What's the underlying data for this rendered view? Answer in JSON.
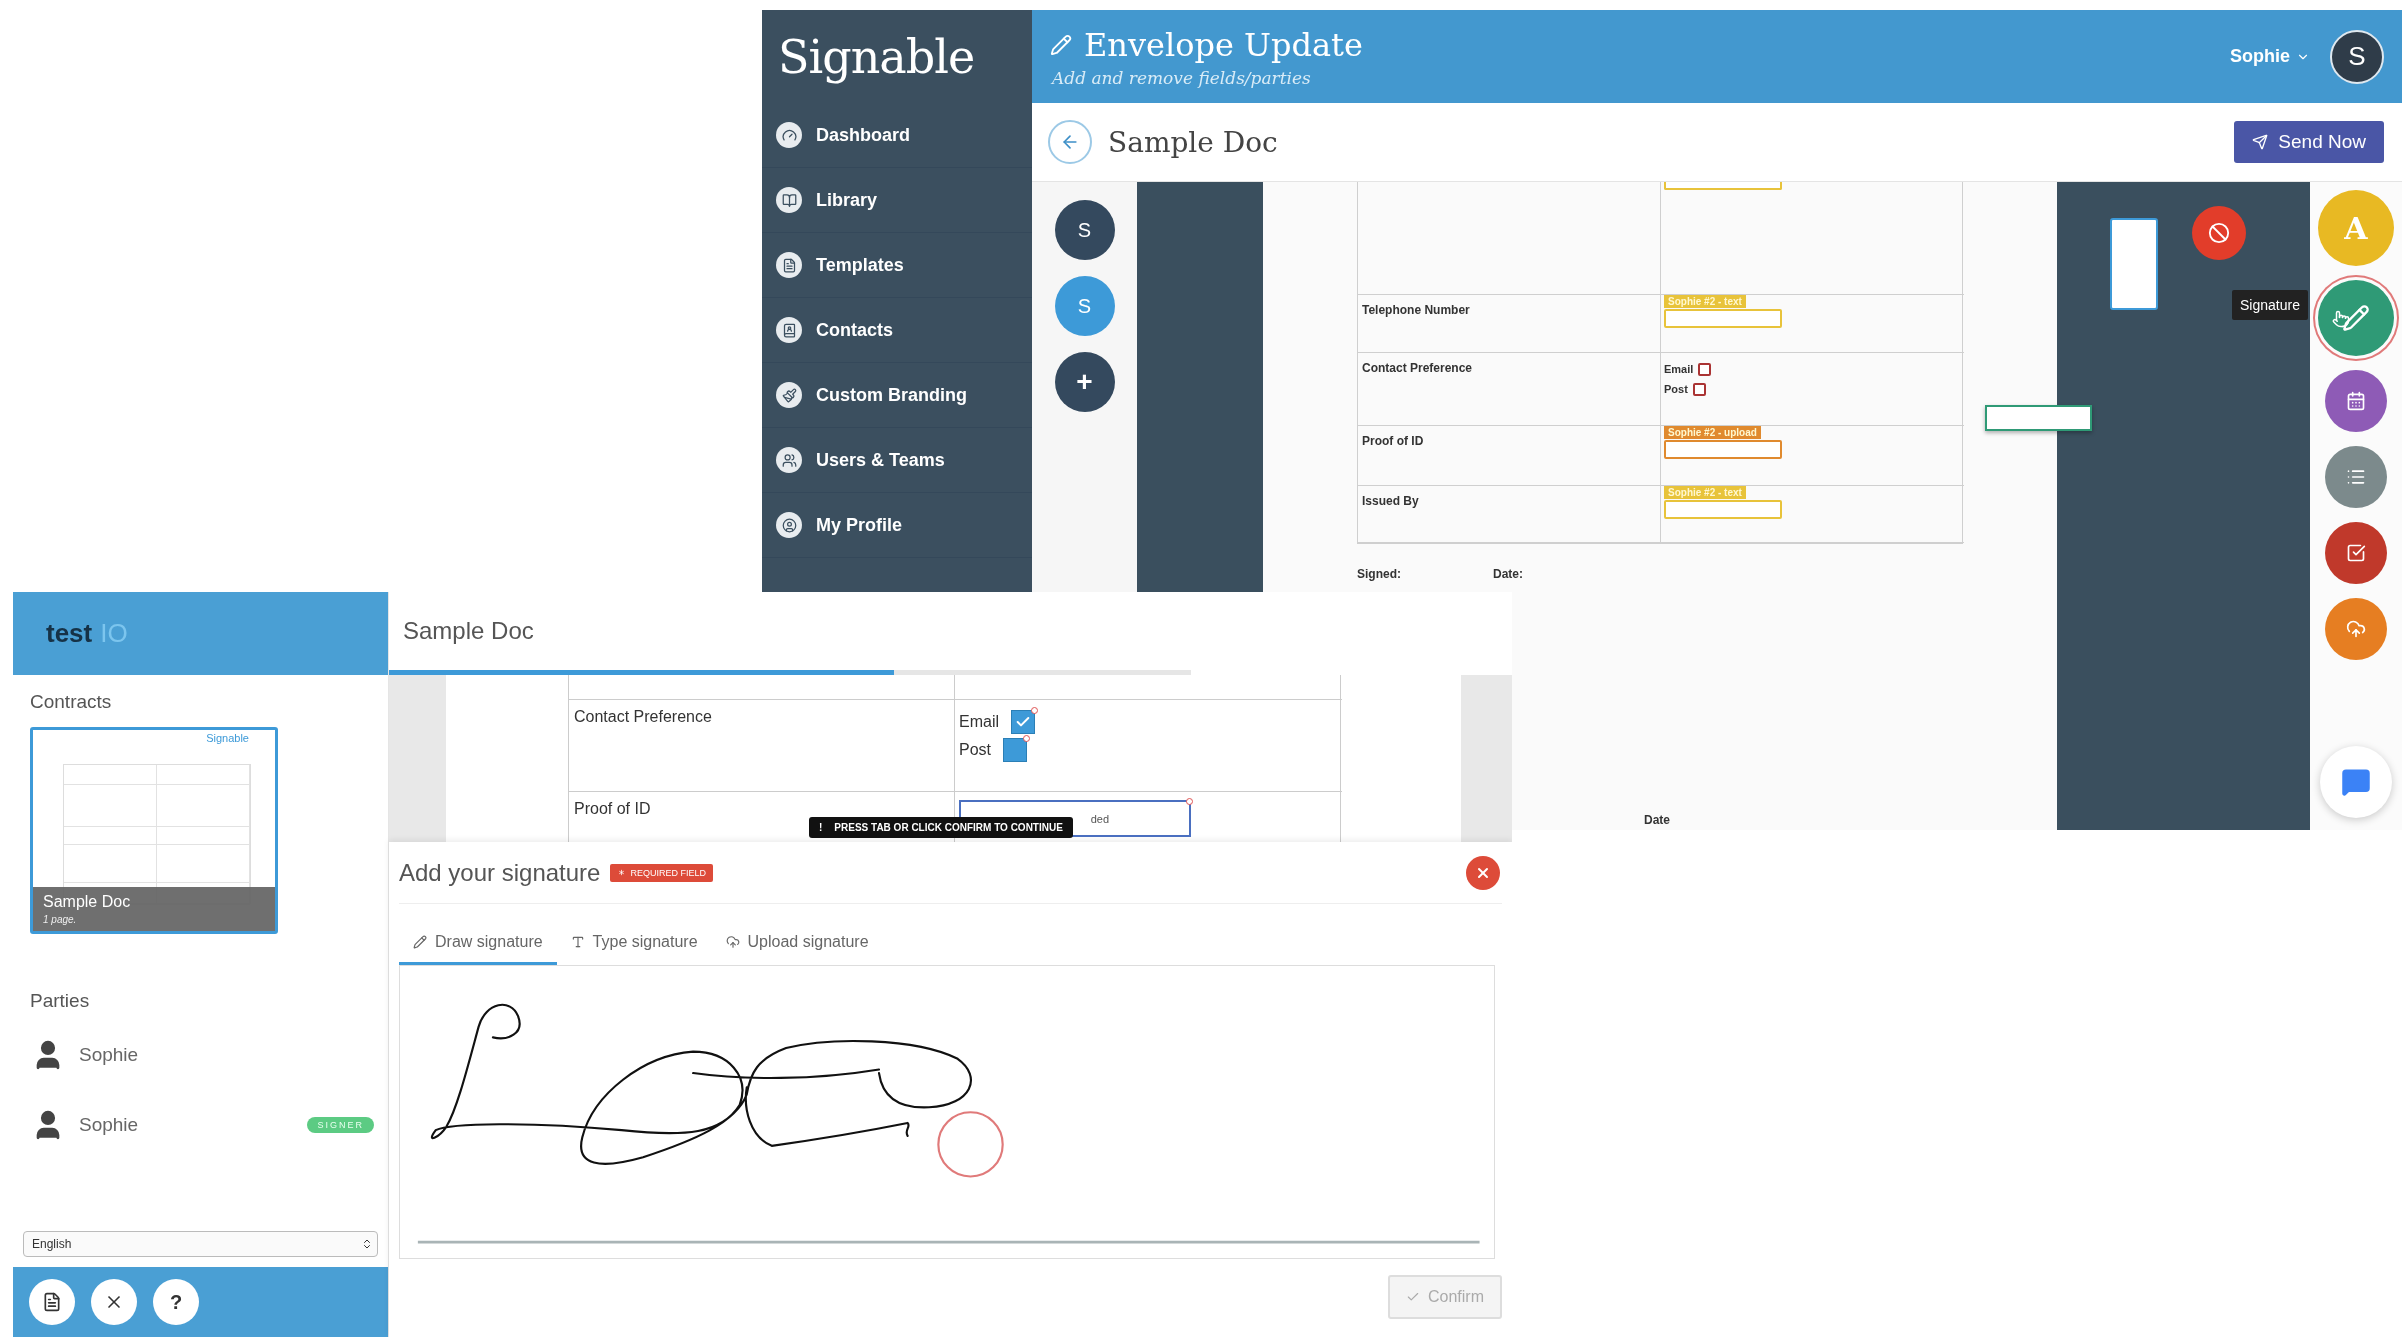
{
  "signable_window": {
    "logo": "Signable",
    "nav": [
      {
        "label": "Dashboard"
      },
      {
        "label": "Library"
      },
      {
        "label": "Templates"
      },
      {
        "label": "Contacts"
      },
      {
        "label": "Custom Branding"
      },
      {
        "label": "Users & Teams"
      },
      {
        "label": "My Profile"
      }
    ],
    "header": {
      "title": "Envelope Update",
      "subtitle": "Add and remove fields/parties",
      "user": "Sophie",
      "avatar": "S"
    },
    "toolbar": {
      "title": "Sample Doc",
      "send_button": "Send Now"
    },
    "parties": [
      {
        "initial": "S",
        "color": "#34495e"
      },
      {
        "initial": "S",
        "color": "#3d9ad8"
      }
    ],
    "add_party": "+",
    "document": {
      "rows": [
        {
          "kind": "field",
          "field": {
            "kind": "text"
          }
        },
        {
          "kind": "field",
          "label": "Telephone Number",
          "field": {
            "kind": "text",
            "tag": "Sophie #2 - text"
          }
        },
        {
          "kind": "options",
          "label": "Contact Preference",
          "options": [
            {
              "label": "Email",
              "checked": false
            },
            {
              "label": "Post",
              "checked": false
            }
          ]
        },
        {
          "kind": "field",
          "label": "Proof of ID",
          "field": {
            "kind": "upload",
            "tag": "Sophie #2 - upload"
          }
        },
        {
          "kind": "field",
          "label": "Issued By",
          "field": {
            "kind": "text",
            "tag": "Sophie #2 - text"
          }
        }
      ],
      "signed_label": "Signed:",
      "date_label": "Date:",
      "lower_date_label": "Date"
    },
    "tooltip": "Signature",
    "tools": [
      {
        "kind": "text",
        "label": "A",
        "color": "#e8b923",
        "hovered": false
      },
      {
        "kind": "signature",
        "color": "#2f9a76",
        "hovered": true
      },
      {
        "kind": "date",
        "color": "#8e5bb6",
        "hovered": false
      },
      {
        "kind": "list",
        "color": "#7c8a8c",
        "hovered": false
      },
      {
        "kind": "checkbox",
        "color": "#c0392b",
        "hovered": false
      },
      {
        "kind": "upload",
        "color": "#e67e22",
        "hovered": false
      }
    ]
  },
  "testio_window": {
    "logo": {
      "text": "test",
      "accent": "IO"
    },
    "contracts_heading": "Contracts",
    "contract": {
      "logo": "Signable",
      "title": "Sample Doc",
      "pages": "1 page.",
      "selected": true
    },
    "parties_heading": "Parties",
    "parties": [
      {
        "name": "Sophie"
      },
      {
        "name": "Sophie",
        "badge": "SIGNER"
      }
    ],
    "language": "English",
    "footer_buttons": [
      {
        "kind": "pdf"
      },
      {
        "kind": "close"
      },
      {
        "kind": "help",
        "label": "?"
      }
    ],
    "doc_title": "Sample Doc",
    "progress": {
      "level": 0.63
    },
    "document": {
      "rows": [
        {
          "kind": "blank"
        },
        {
          "kind": "options",
          "label": "Contact Preference",
          "options": [
            {
              "label": "Email",
              "checked": true
            },
            {
              "label": "Post",
              "checked": false
            }
          ]
        },
        {
          "kind": "field",
          "label": "Proof of ID",
          "field": {
            "kind": "upload",
            "value": "ded"
          }
        }
      ]
    },
    "hint": {
      "mark": "!",
      "text": "PRESS TAB OR CLICK CONFIRM TO CONTINUE"
    },
    "modal": {
      "title": "Add your signature",
      "badge": "REQUIRED FIELD",
      "tabs": [
        {
          "kind": "draw",
          "label": "Draw signature",
          "selected": true
        },
        {
          "kind": "type",
          "label": "Type signature",
          "selected": false
        },
        {
          "kind": "upload",
          "label": "Upload signature",
          "selected": false
        }
      ],
      "confirm": {
        "label": "Confirm",
        "disabled": true
      }
    }
  }
}
